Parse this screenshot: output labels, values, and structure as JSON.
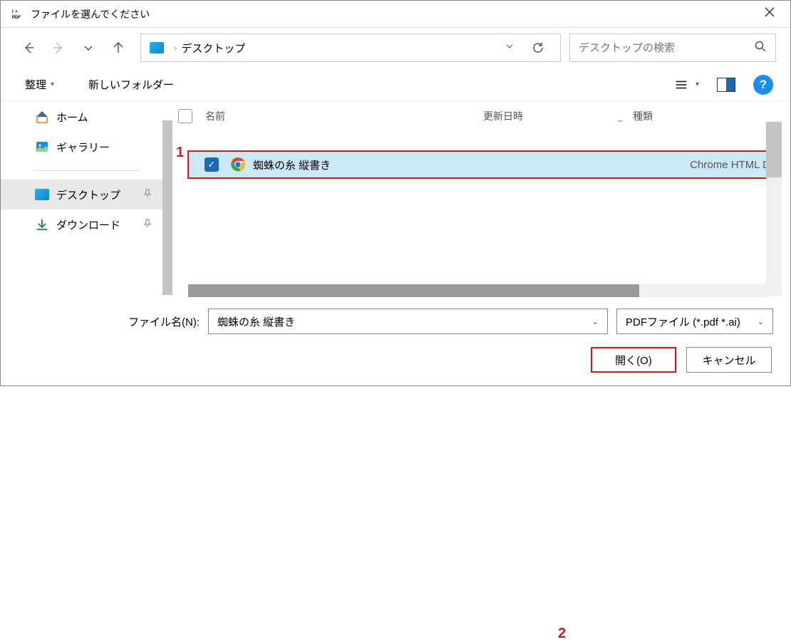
{
  "titlebar": {
    "title": "ファイルを選んでください"
  },
  "navbar": {
    "breadcrumb_current": "デスクトップ",
    "search_placeholder": "デスクトップの検索"
  },
  "toolbar": {
    "organize": "整理",
    "new_folder": "新しいフォルダー"
  },
  "sidebar": {
    "items": [
      {
        "label": "ホーム"
      },
      {
        "label": "ギャラリー"
      },
      {
        "label": "デスクトップ"
      },
      {
        "label": "ダウンロード"
      }
    ]
  },
  "list": {
    "columns": {
      "name": "名前",
      "date": "更新日時",
      "type": "種類"
    },
    "rows": [
      {
        "name": "蜘蛛の糸 縦書き",
        "type": "Chrome HTML D",
        "checked": true
      }
    ]
  },
  "bottom": {
    "filename_label": "ファイル名(N):",
    "filename_value": "蜘蛛の糸 縦書き",
    "filetype_value": "PDFファイル (*.pdf *.ai)",
    "open_btn": "開く(O)",
    "cancel_btn": "キャンセル"
  },
  "annotations": {
    "one": "1",
    "two": "2"
  }
}
